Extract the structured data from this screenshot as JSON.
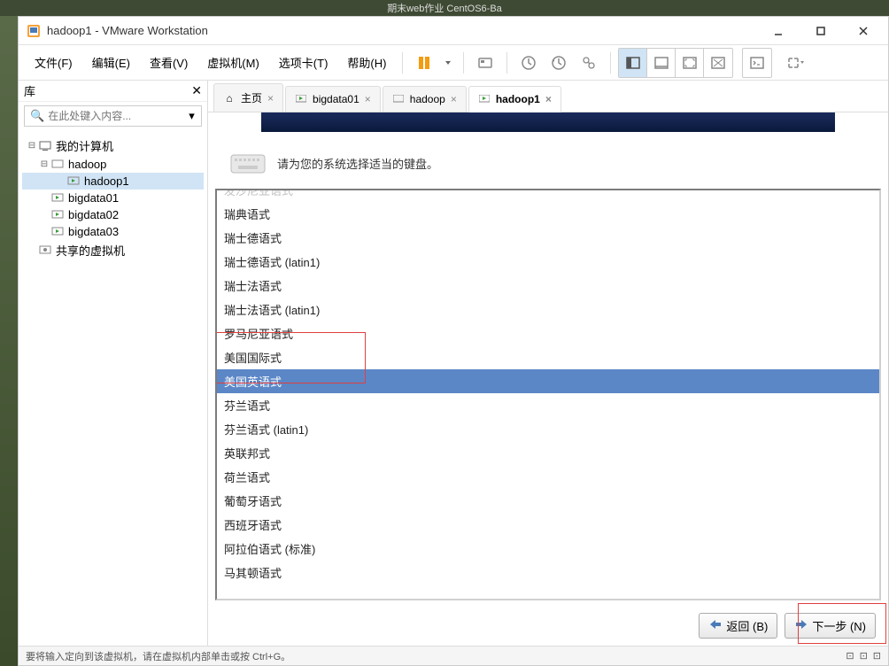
{
  "desktop": {
    "top_text": "期末web作业  CentOS6-Ba"
  },
  "window": {
    "title": "hadoop1 - VMware Workstation"
  },
  "menu": {
    "file": "文件(F)",
    "edit": "编辑(E)",
    "view": "查看(V)",
    "vm": "虚拟机(M)",
    "tabs": "选项卡(T)",
    "help": "帮助(H)"
  },
  "sidebar": {
    "title": "库",
    "search_placeholder": "在此处键入内容...",
    "tree": {
      "root": "我的计算机",
      "items": [
        "hadoop",
        "hadoop1",
        "bigdata01",
        "bigdata02",
        "bigdata03"
      ],
      "shared": "共享的虚拟机"
    }
  },
  "tabs": {
    "home": "主页",
    "items": [
      "bigdata01",
      "hadoop",
      "hadoop1"
    ]
  },
  "installer": {
    "prompt": "请为您的系统选择适当的键盘。",
    "list": [
      "瑞典语式",
      "瑞士德语式",
      "瑞士德语式 (latin1)",
      "瑞士法语式",
      "瑞士法语式 (latin1)",
      "罗马尼亚语式",
      "美国国际式",
      "美国英语式",
      "芬兰语式",
      "芬兰语式 (latin1)",
      "英联邦式",
      "荷兰语式",
      "葡萄牙语式",
      "西班牙语式",
      "阿拉伯语式 (标准)",
      "马其顿语式"
    ],
    "truncated_top": "发沙尼亚语式",
    "back": "返回 (B)",
    "next": "下一步 (N)"
  },
  "statusbar": {
    "hint": "要将输入定向到该虚拟机，请在虚拟机内部单击或按 Ctrl+G。"
  }
}
